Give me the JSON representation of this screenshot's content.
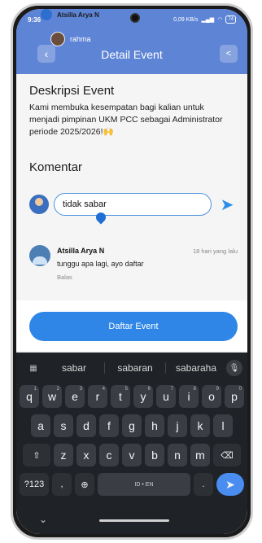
{
  "status": {
    "time": "9:36",
    "speed": "0,09 KB/s",
    "battery": "74"
  },
  "notification": {
    "title": "Atsilla Arya N",
    "user": "rahma"
  },
  "header": {
    "title": "Detail Event"
  },
  "description": {
    "heading": "Deskripsi Event",
    "text": "Kami membuka kesempatan bagi kalian untuk menjadi pimpinan UKM PCC sebagai Administrator periode 2025/2026!🙌"
  },
  "comments_section": {
    "heading": "Komentar",
    "input_value": "tidak sabar",
    "comment": {
      "author": "Atsilla Arya N",
      "time": "18 hari yang lalu",
      "text": "tunggu apa lagi, ayo daftar",
      "reply_label": "Balas"
    }
  },
  "action": {
    "button_label": "Daftar Event"
  },
  "keyboard": {
    "suggestions": [
      "sabar",
      "sabaran",
      "sabaraha"
    ],
    "row1": [
      "q",
      "w",
      "e",
      "r",
      "t",
      "y",
      "u",
      "i",
      "o",
      "p"
    ],
    "row1_nums": [
      "1",
      "2",
      "3",
      "4",
      "5",
      "6",
      "7",
      "8",
      "9",
      "0"
    ],
    "row2": [
      "a",
      "s",
      "d",
      "f",
      "g",
      "h",
      "j",
      "k",
      "l"
    ],
    "row3": [
      "z",
      "x",
      "c",
      "v",
      "b",
      "n",
      "m"
    ],
    "symbols_label": "?123",
    "space_label": "ID • EN",
    "period_label": ".",
    "comma_label": ","
  },
  "colors": {
    "header": "#5e84d6",
    "primary": "#2f86e6",
    "keyboard": "#1f2327"
  }
}
